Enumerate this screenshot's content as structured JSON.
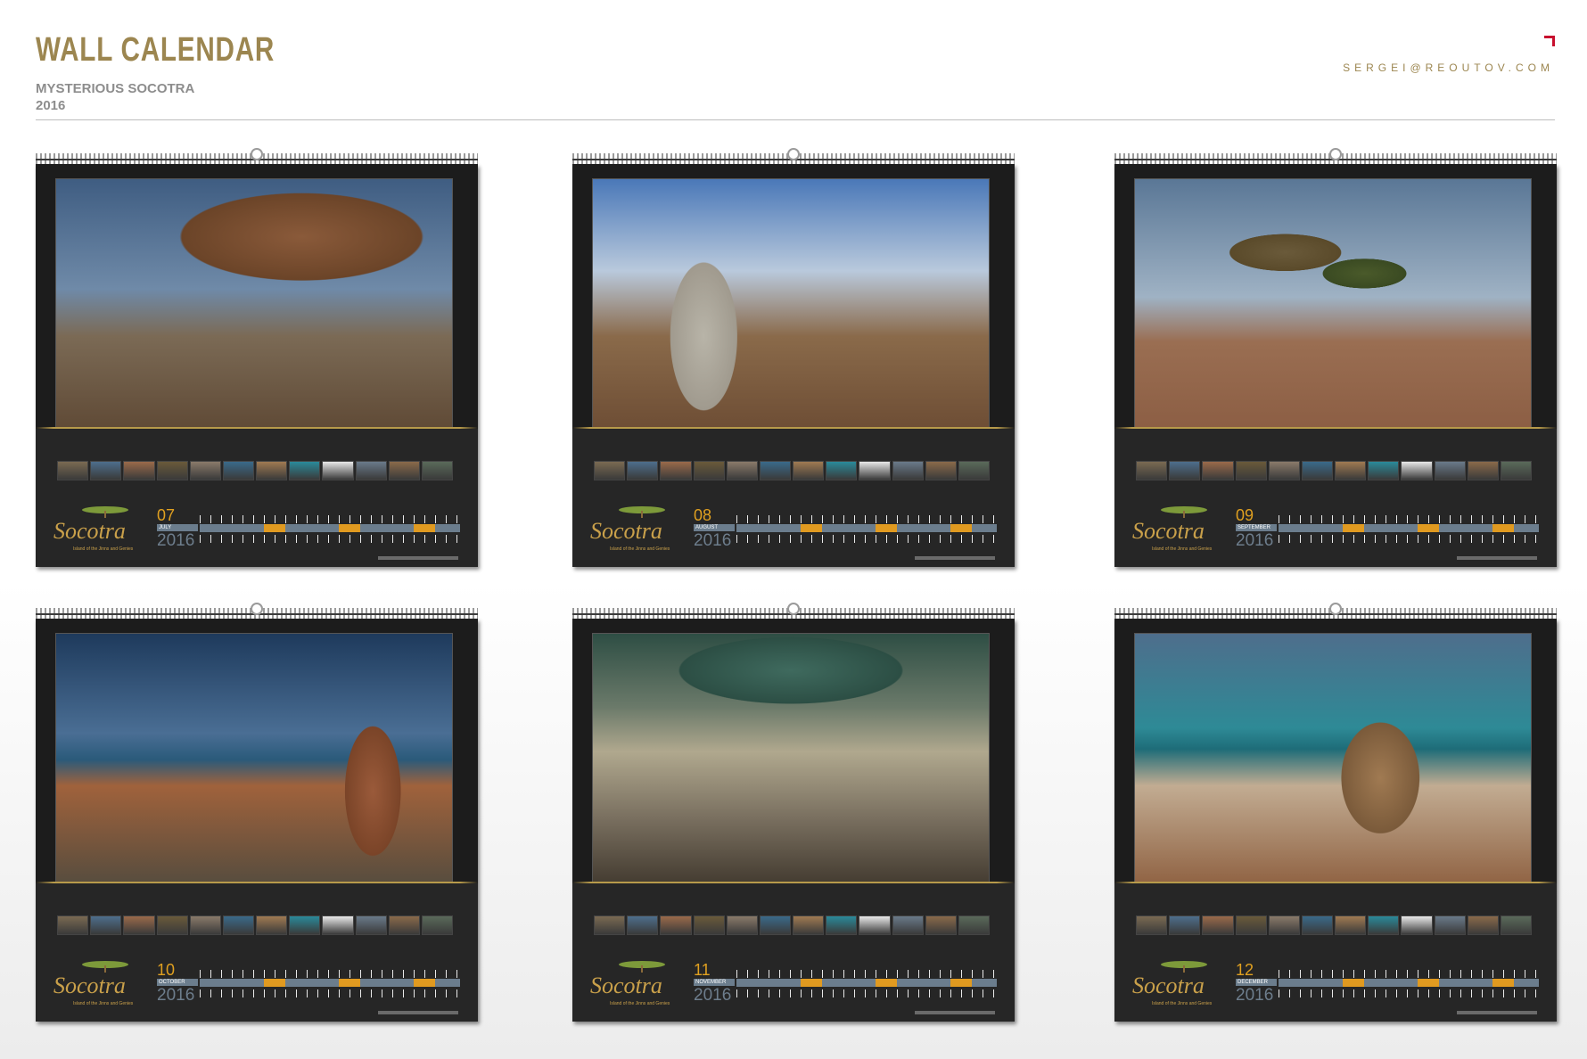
{
  "header": {
    "title": "WALL CALENDAR",
    "subtitle": "MYSTERIOUS SOCOTRA",
    "year": "2016",
    "email": "SERGEI@REOUTOV.COM"
  },
  "brand": {
    "logo_text": "Socotra",
    "tagline": "Island of the Jinns and Genies",
    "accent_color": "#9c8650",
    "corner_color": "#c8102e"
  },
  "calendars": [
    {
      "month_number": "07",
      "month_name": "JULY",
      "year": "2016",
      "photo": "dragon-blood-trees-and-desert-roses"
    },
    {
      "month_number": "08",
      "month_name": "AUGUST",
      "year": "2016",
      "photo": "bottle-tree-with-dragon-trees"
    },
    {
      "month_number": "09",
      "month_name": "SEPTEMBER",
      "year": "2016",
      "photo": "dragon-blood-trees-on-plain"
    },
    {
      "month_number": "10",
      "month_name": "OCTOBER",
      "year": "2016",
      "photo": "desert-roses-by-sea"
    },
    {
      "month_number": "11",
      "month_name": "NOVEMBER",
      "year": "2016",
      "photo": "dragon-tree-canopy-closeup"
    },
    {
      "month_number": "12",
      "month_name": "DECEMBER",
      "year": "2016",
      "photo": "desert-rose-on-rocks-by-sea"
    }
  ]
}
